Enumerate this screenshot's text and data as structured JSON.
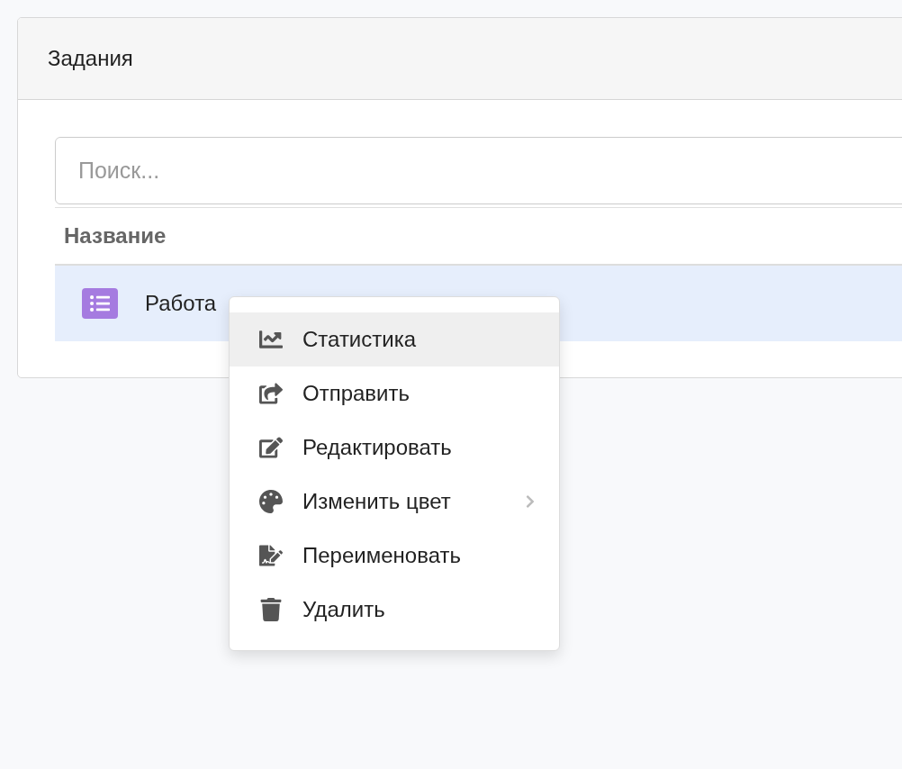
{
  "card": {
    "title": "Задания"
  },
  "search": {
    "placeholder": "Поиск..."
  },
  "table": {
    "columns": [
      "Название"
    ],
    "rows": [
      {
        "name": "Работа",
        "selected": true,
        "color": "#a57be0"
      }
    ]
  },
  "context_menu": {
    "items": [
      {
        "label": "Статистика",
        "selected": true
      },
      {
        "label": "Отправить",
        "selected": false
      },
      {
        "label": "Редактировать",
        "selected": false
      },
      {
        "label": "Изменить цвет",
        "selected": false,
        "submenu": true
      },
      {
        "label": "Переименовать",
        "selected": false
      },
      {
        "label": "Удалить",
        "selected": false
      }
    ]
  }
}
